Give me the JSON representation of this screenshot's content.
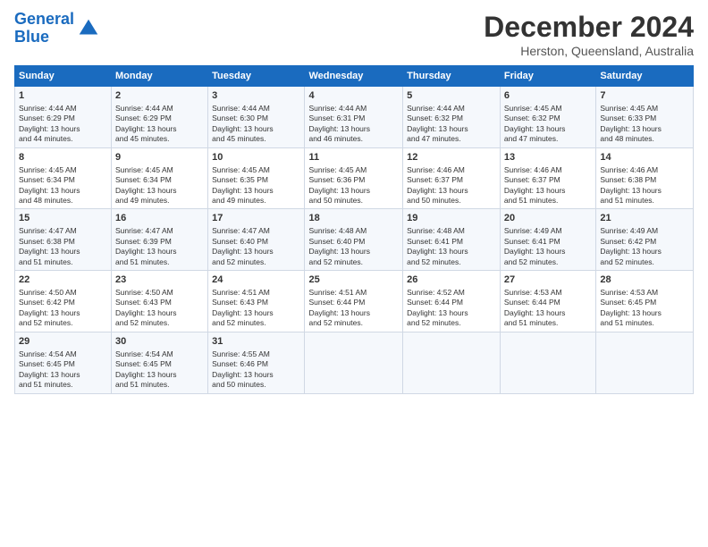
{
  "logo": {
    "line1": "General",
    "line2": "Blue"
  },
  "title": "December 2024",
  "subtitle": "Herston, Queensland, Australia",
  "days_of_week": [
    "Sunday",
    "Monday",
    "Tuesday",
    "Wednesday",
    "Thursday",
    "Friday",
    "Saturday"
  ],
  "weeks": [
    [
      {
        "day": "1",
        "sunrise": "4:44 AM",
        "sunset": "6:29 PM",
        "daylight": "13 hours and 44 minutes."
      },
      {
        "day": "2",
        "sunrise": "4:44 AM",
        "sunset": "6:29 PM",
        "daylight": "13 hours and 45 minutes."
      },
      {
        "day": "3",
        "sunrise": "4:44 AM",
        "sunset": "6:30 PM",
        "daylight": "13 hours and 45 minutes."
      },
      {
        "day": "4",
        "sunrise": "4:44 AM",
        "sunset": "6:31 PM",
        "daylight": "13 hours and 46 minutes."
      },
      {
        "day": "5",
        "sunrise": "4:44 AM",
        "sunset": "6:32 PM",
        "daylight": "13 hours and 47 minutes."
      },
      {
        "day": "6",
        "sunrise": "4:45 AM",
        "sunset": "6:32 PM",
        "daylight": "13 hours and 47 minutes."
      },
      {
        "day": "7",
        "sunrise": "4:45 AM",
        "sunset": "6:33 PM",
        "daylight": "13 hours and 48 minutes."
      }
    ],
    [
      {
        "day": "8",
        "sunrise": "4:45 AM",
        "sunset": "6:34 PM",
        "daylight": "13 hours and 48 minutes."
      },
      {
        "day": "9",
        "sunrise": "4:45 AM",
        "sunset": "6:34 PM",
        "daylight": "13 hours and 49 minutes."
      },
      {
        "day": "10",
        "sunrise": "4:45 AM",
        "sunset": "6:35 PM",
        "daylight": "13 hours and 49 minutes."
      },
      {
        "day": "11",
        "sunrise": "4:45 AM",
        "sunset": "6:36 PM",
        "daylight": "13 hours and 50 minutes."
      },
      {
        "day": "12",
        "sunrise": "4:46 AM",
        "sunset": "6:37 PM",
        "daylight": "13 hours and 50 minutes."
      },
      {
        "day": "13",
        "sunrise": "4:46 AM",
        "sunset": "6:37 PM",
        "daylight": "13 hours and 51 minutes."
      },
      {
        "day": "14",
        "sunrise": "4:46 AM",
        "sunset": "6:38 PM",
        "daylight": "13 hours and 51 minutes."
      }
    ],
    [
      {
        "day": "15",
        "sunrise": "4:47 AM",
        "sunset": "6:38 PM",
        "daylight": "13 hours and 51 minutes."
      },
      {
        "day": "16",
        "sunrise": "4:47 AM",
        "sunset": "6:39 PM",
        "daylight": "13 hours and 51 minutes."
      },
      {
        "day": "17",
        "sunrise": "4:47 AM",
        "sunset": "6:40 PM",
        "daylight": "13 hours and 52 minutes."
      },
      {
        "day": "18",
        "sunrise": "4:48 AM",
        "sunset": "6:40 PM",
        "daylight": "13 hours and 52 minutes."
      },
      {
        "day": "19",
        "sunrise": "4:48 AM",
        "sunset": "6:41 PM",
        "daylight": "13 hours and 52 minutes."
      },
      {
        "day": "20",
        "sunrise": "4:49 AM",
        "sunset": "6:41 PM",
        "daylight": "13 hours and 52 minutes."
      },
      {
        "day": "21",
        "sunrise": "4:49 AM",
        "sunset": "6:42 PM",
        "daylight": "13 hours and 52 minutes."
      }
    ],
    [
      {
        "day": "22",
        "sunrise": "4:50 AM",
        "sunset": "6:42 PM",
        "daylight": "13 hours and 52 minutes."
      },
      {
        "day": "23",
        "sunrise": "4:50 AM",
        "sunset": "6:43 PM",
        "daylight": "13 hours and 52 minutes."
      },
      {
        "day": "24",
        "sunrise": "4:51 AM",
        "sunset": "6:43 PM",
        "daylight": "13 hours and 52 minutes."
      },
      {
        "day": "25",
        "sunrise": "4:51 AM",
        "sunset": "6:44 PM",
        "daylight": "13 hours and 52 minutes."
      },
      {
        "day": "26",
        "sunrise": "4:52 AM",
        "sunset": "6:44 PM",
        "daylight": "13 hours and 52 minutes."
      },
      {
        "day": "27",
        "sunrise": "4:53 AM",
        "sunset": "6:44 PM",
        "daylight": "13 hours and 51 minutes."
      },
      {
        "day": "28",
        "sunrise": "4:53 AM",
        "sunset": "6:45 PM",
        "daylight": "13 hours and 51 minutes."
      }
    ],
    [
      {
        "day": "29",
        "sunrise": "4:54 AM",
        "sunset": "6:45 PM",
        "daylight": "13 hours and 51 minutes."
      },
      {
        "day": "30",
        "sunrise": "4:54 AM",
        "sunset": "6:45 PM",
        "daylight": "13 hours and 51 minutes."
      },
      {
        "day": "31",
        "sunrise": "4:55 AM",
        "sunset": "6:46 PM",
        "daylight": "13 hours and 50 minutes."
      },
      null,
      null,
      null,
      null
    ]
  ]
}
